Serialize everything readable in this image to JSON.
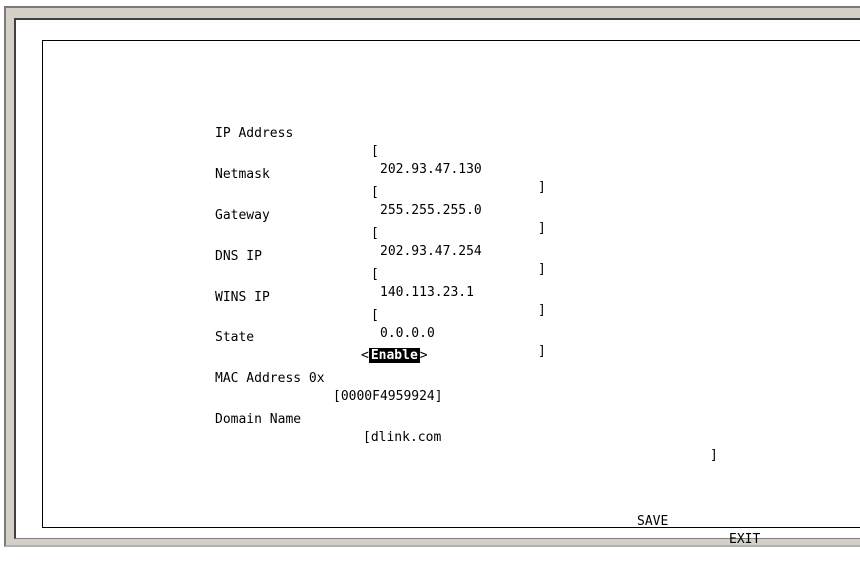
{
  "fields": [
    {
      "label": "IP Address",
      "value": "202.93.47.130",
      "close": "]"
    },
    {
      "label": "Netmask",
      "value": "255.255.255.0",
      "close": "]"
    },
    {
      "label": "Gateway",
      "value": "202.93.47.254",
      "close": "]"
    },
    {
      "label": "DNS IP",
      "value": "140.113.23.1",
      "close": "]"
    },
    {
      "label": "WINS IP",
      "value": "0.0.0.0",
      "close": "]"
    }
  ],
  "state": {
    "label": "State",
    "left_arrow": "<",
    "value": "Enable",
    "right_arrow": ">"
  },
  "mac": {
    "label": "MAC Address 0x",
    "value": "[0000F4959924]"
  },
  "domain": {
    "label": "Domain Name",
    "value": "[dlink.com",
    "close": "]"
  },
  "actions": {
    "save_label": "SAVE",
    "exit_label": "EXIT"
  }
}
